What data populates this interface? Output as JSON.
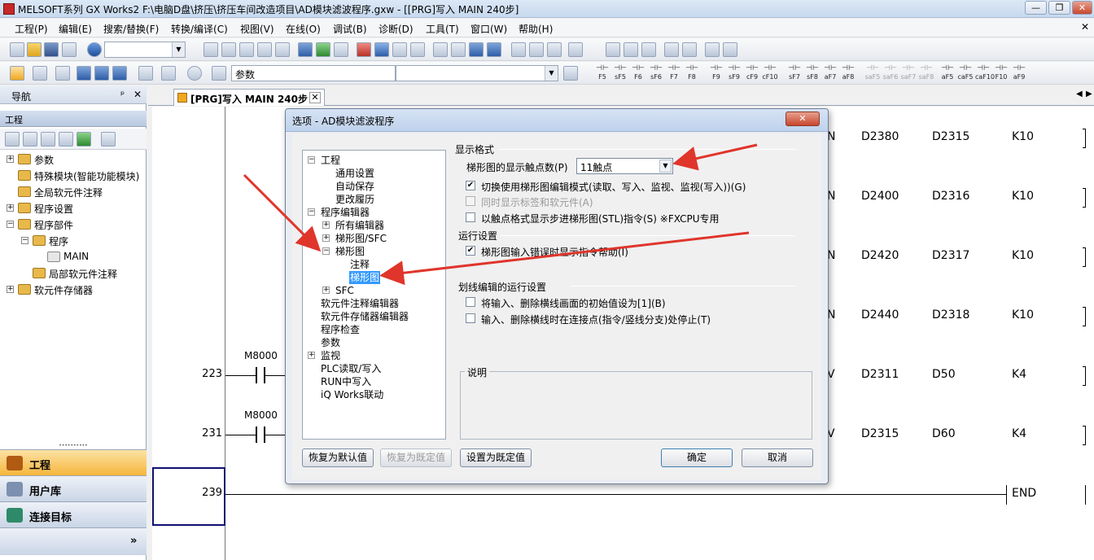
{
  "app": {
    "title": "MELSOFT系列 GX Works2 F:\\电脑D盘\\挤压\\挤压车间改造项目\\AD模块滤波程序.gxw - [[PRG]写入 MAIN 240步]",
    "minimize": "—",
    "restore": "❐",
    "close": "✕"
  },
  "menu": [
    "工程(P)",
    "编辑(E)",
    "搜索/替换(F)",
    "转换/编译(C)",
    "视图(V)",
    "在线(O)",
    "调试(B)",
    "诊断(D)",
    "工具(T)",
    "窗口(W)",
    "帮助(H)"
  ],
  "toolbar2": {
    "search_label": "参数"
  },
  "function_keys": [
    "F5",
    "sF5",
    "F6",
    "sF6",
    "F7",
    "F8",
    "F9",
    "sF9",
    "cF9",
    "cF10",
    "sF7",
    "sF8",
    "aF7",
    "aF8",
    "saF5",
    "saF6",
    "saF7",
    "saF8",
    "aF5",
    "caF5",
    "caF10",
    "F10",
    "aF9"
  ],
  "nav": {
    "title": "导航",
    "pin": "ᵖ",
    "close": "✕",
    "section": "工程",
    "items": [
      {
        "label": "参数",
        "indent": 0,
        "exp": "+"
      },
      {
        "label": "特殊模块(智能功能模块)",
        "indent": 0,
        "exp": ""
      },
      {
        "label": "全局软元件注释",
        "indent": 0,
        "exp": ""
      },
      {
        "label": "程序设置",
        "indent": 0,
        "exp": "+"
      },
      {
        "label": "程序部件",
        "indent": 0,
        "exp": "−"
      },
      {
        "label": "程序",
        "indent": 1,
        "exp": "−"
      },
      {
        "label": "MAIN",
        "indent": 2,
        "exp": ""
      },
      {
        "label": "局部软元件注释",
        "indent": 1,
        "exp": ""
      },
      {
        "label": "软元件存储器",
        "indent": 0,
        "exp": "+"
      }
    ],
    "sections": [
      {
        "label": "工程",
        "active": true
      },
      {
        "label": "用户库",
        "active": false
      },
      {
        "label": "连接目标",
        "active": false
      }
    ],
    "more": "»"
  },
  "editor": {
    "tab_label": "[PRG]写入 MAIN 240步",
    "tab_close": "✕",
    "rows": [
      {
        "col0": "N",
        "col1": "D2380",
        "col2": "D2315",
        "col3": "K10"
      },
      {
        "col0": "N",
        "col1": "D2400",
        "col2": "D2316",
        "col3": "K10"
      },
      {
        "col0": "N",
        "col1": "D2420",
        "col2": "D2317",
        "col3": "K10"
      },
      {
        "col0": "N",
        "col1": "D2440",
        "col2": "D2318",
        "col3": "K10"
      },
      {
        "col0": "V",
        "col1": "D2311",
        "col2": "D50",
        "col3": "K4"
      },
      {
        "col0": "V",
        "col1": "D2315",
        "col2": "D60",
        "col3": "K4"
      }
    ],
    "rung1": {
      "step": "223",
      "contact": "M8000"
    },
    "rung2": {
      "step": "231",
      "contact": "M8000"
    },
    "rung3": {
      "step": "239",
      "instr": "END"
    }
  },
  "dialog": {
    "title": "选项 - AD模块滤波程序",
    "close": "✕",
    "tree": [
      {
        "label": "工程",
        "indent": 0,
        "exp": "−"
      },
      {
        "label": "通用设置",
        "indent": 1,
        "exp": ""
      },
      {
        "label": "自动保存",
        "indent": 1,
        "exp": ""
      },
      {
        "label": "更改履历",
        "indent": 1,
        "exp": ""
      },
      {
        "label": "程序编辑器",
        "indent": 0,
        "exp": "−"
      },
      {
        "label": "所有编辑器",
        "indent": 1,
        "exp": "+"
      },
      {
        "label": "梯形图/SFC",
        "indent": 1,
        "exp": "+"
      },
      {
        "label": "梯形图",
        "indent": 1,
        "exp": "−"
      },
      {
        "label": "注释",
        "indent": 2,
        "exp": ""
      },
      {
        "label": "梯形图",
        "indent": 2,
        "exp": "",
        "selected": true
      },
      {
        "label": "SFC",
        "indent": 1,
        "exp": "+"
      },
      {
        "label": "软元件注释编辑器",
        "indent": 0,
        "exp": ""
      },
      {
        "label": "软元件存储器编辑器",
        "indent": 0,
        "exp": ""
      },
      {
        "label": "程序检查",
        "indent": 0,
        "exp": ""
      },
      {
        "label": "参数",
        "indent": 0,
        "exp": ""
      },
      {
        "label": "监视",
        "indent": 0,
        "exp": "+"
      },
      {
        "label": "PLC读取/写入",
        "indent": 0,
        "exp": ""
      },
      {
        "label": "RUN中写入",
        "indent": 0,
        "exp": ""
      },
      {
        "label": "iQ Works联动",
        "indent": 0,
        "exp": ""
      }
    ],
    "display_format": {
      "group": "显示格式",
      "contacts_label": "梯形图的显示触点数(P)",
      "contacts_value": "11触点",
      "opt1": "切换使用梯形图编辑模式(读取、写入、监视、监视(写入))(G)",
      "opt1_checked": true,
      "opt2": "同时显示标签和软元件(A)",
      "opt2_checked": false,
      "opt3": "以触点格式显示步进梯形图(STL)指令(S) ※FXCPU专用",
      "opt3_checked": false
    },
    "run_settings": {
      "group": "运行设置",
      "opt1": "梯形图输入错误时显示指令帮助(I)",
      "opt1_checked": true
    },
    "line_edit": {
      "group": "划线编辑的运行设置",
      "opt1": "将输入、删除横线画面的初始值设为[1](B)",
      "opt2": "输入、删除横线时在连接点(指令/竖线分支)处停止(T)"
    },
    "desc_group": "说明",
    "buttons": {
      "restore_default": "恢复为默认值",
      "restore_preset": "恢复为既定值",
      "set_preset": "设置为既定值",
      "ok": "确定",
      "cancel": "取消"
    }
  },
  "colors": {
    "arrow": "#e0352b",
    "selection": "#3399ff",
    "active_section": "#f5b63c"
  }
}
